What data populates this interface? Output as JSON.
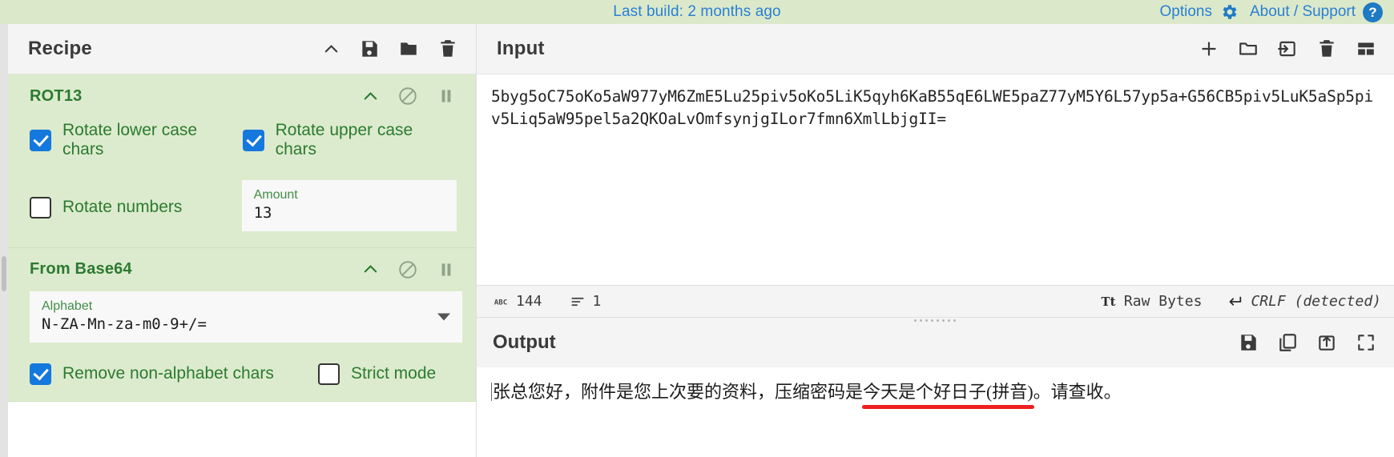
{
  "banner": {
    "build_text": "Last build: 2 months ago",
    "options_label": "Options",
    "options_icon": "gear-icon",
    "about_label": "About / Support",
    "about_icon": "question-circle-icon",
    "link_color": "#2a7fd4",
    "background": "#dbe9ca"
  },
  "recipe": {
    "title": "Recipe",
    "icons": [
      "chevron-up-icon",
      "save-icon",
      "folder-icon",
      "trash-icon"
    ],
    "operations": [
      {
        "name": "ROT13",
        "icons": [
          "chevron-up-icon",
          "disable-icon",
          "pause-icon"
        ],
        "checkboxes": [
          {
            "label": "Rotate lower case chars",
            "checked": true
          },
          {
            "label": "Rotate upper case chars",
            "checked": true
          },
          {
            "label": "Rotate numbers",
            "checked": false
          }
        ],
        "args": [
          {
            "label": "Amount",
            "value": "13",
            "type": "number"
          }
        ]
      },
      {
        "name": "From Base64",
        "icons": [
          "chevron-up-icon",
          "disable-icon",
          "pause-icon"
        ],
        "args": [
          {
            "label": "Alphabet",
            "value": "N-ZA-Mn-za-m0-9+/=",
            "type": "select"
          }
        ],
        "checkboxes": [
          {
            "label": "Remove non-alphabet chars",
            "checked": true
          },
          {
            "label": "Strict mode",
            "checked": false
          }
        ]
      }
    ],
    "operation_bg": "#dcebcd",
    "operation_text_color": "#2c7a32"
  },
  "input": {
    "title": "Input",
    "icons": [
      "plus-icon",
      "folder-open-icon",
      "import-icon",
      "trash-icon",
      "tabs-icon"
    ],
    "value": "5byg5oC75oKo5aW977yM6ZmE5Lu25piv5oKo5LiK5qyh6KaB55qE6LWE5paZ77yM5Y6L57yp5a+G56CB5piv5LuK5aSp5piv5Liq5aW95pel5a2QKOaLvOmfsynjgILor7fmn6XmlLbjgII=",
    "status": {
      "length_icon": "abc-icon",
      "length": "144",
      "lines_icon": "lines-icon",
      "lines": "1",
      "encoding_icon": "font-size-icon",
      "encoding": "Raw Bytes",
      "line_ending_icon": "return-arrow-icon",
      "line_ending": "CRLF (detected)"
    }
  },
  "output": {
    "title": "Output",
    "icons": [
      "save-icon",
      "copy-icon",
      "open-in-tab-icon",
      "maximise-icon"
    ],
    "text_before": "张总您好，附件是您上次要的资料，压缩密码是",
    "text_highlight": "今天是个好日子(拼音)",
    "text_after": "。请查收。",
    "highlight_color": "#f02020"
  }
}
